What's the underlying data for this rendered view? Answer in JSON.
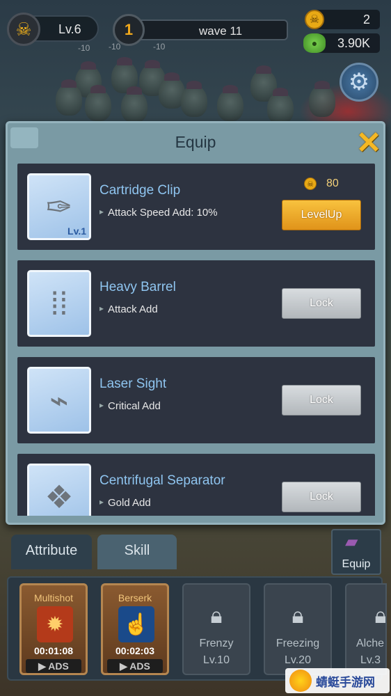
{
  "hud": {
    "level": "Lv.6",
    "wave_number": "1",
    "wave_label": "wave 11",
    "skull_currency": "2",
    "gem_currency": "3.90K"
  },
  "damage_floaters": [
    "-10",
    "-10",
    "-10"
  ],
  "modal": {
    "title": "Equip",
    "items": [
      {
        "name": "Cartridge Clip",
        "desc": "Attack Speed Add: 10%",
        "level": "Lv.1",
        "cost": "80",
        "button": "LevelUp",
        "icon": "cartridge-clip-icon"
      },
      {
        "name": "Heavy Barrel",
        "desc": "Attack Add",
        "button": "Lock",
        "icon": "bullets-icon"
      },
      {
        "name": "Laser Sight",
        "desc": "Critical Add",
        "button": "Lock",
        "icon": "laser-sight-icon"
      },
      {
        "name": "Centrifugal Separator",
        "desc": "Gold Add",
        "button": "Lock",
        "icon": "separator-icon"
      }
    ]
  },
  "tabs": {
    "attribute": "Attribute",
    "skill": "Skill",
    "equip": "Equip"
  },
  "skills": [
    {
      "name": "Multishot",
      "timer": "00:01:08",
      "ads": "ADS"
    },
    {
      "name": "Berserk",
      "timer": "00:02:03",
      "ads": "ADS"
    },
    {
      "name": "Frenzy",
      "level": "Lv.10"
    },
    {
      "name": "Freezing",
      "level": "Lv.20"
    },
    {
      "name": "Alche",
      "level": "Lv.3"
    }
  ],
  "colors": {
    "accent_gold": "#f5b824",
    "item_name": "#8fc5f0",
    "panel": "#2d3340"
  }
}
